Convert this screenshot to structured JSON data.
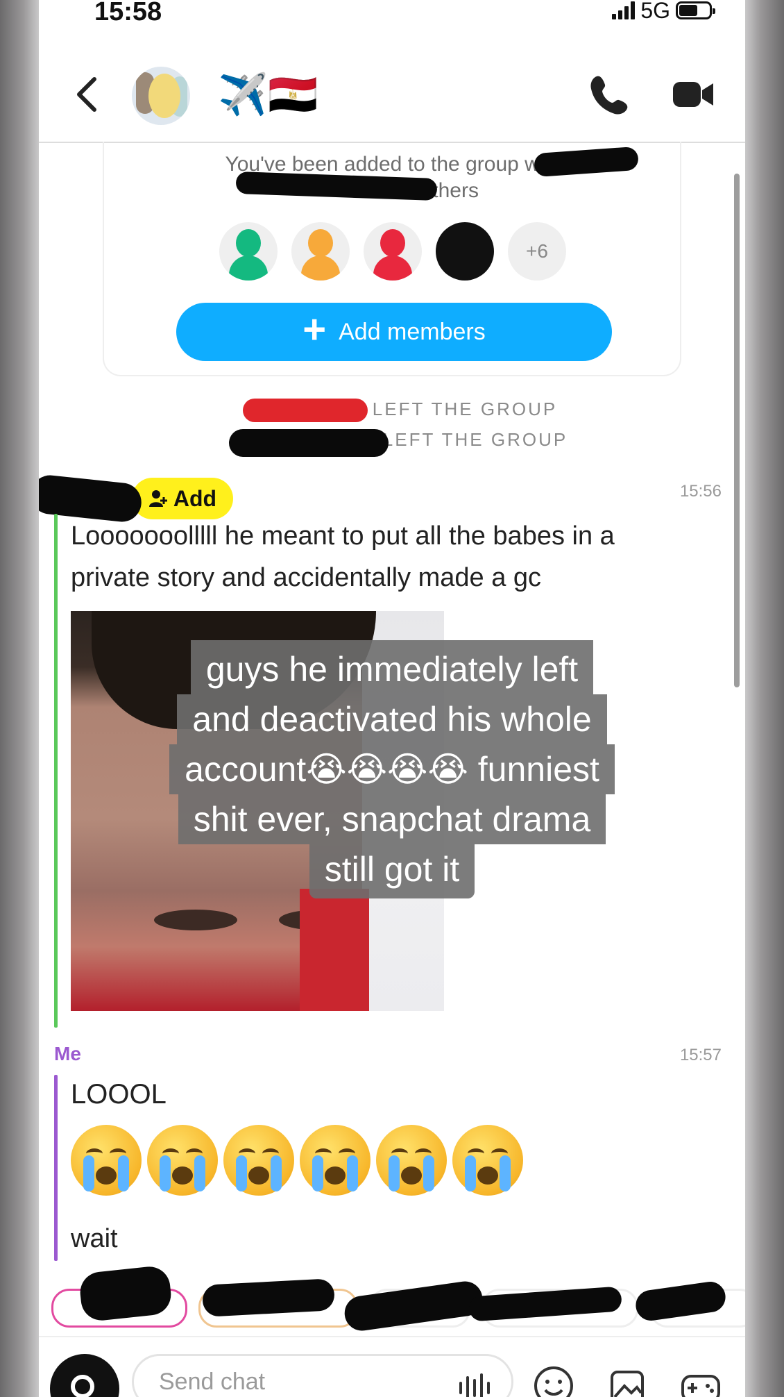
{
  "status_bar": {
    "time": "15:58",
    "network": "5G"
  },
  "header": {
    "group_name": "✈️🇪🇬"
  },
  "group_card": {
    "added_text": "You've been added to the group with",
    "others_text": "+6 others",
    "more_count": "+6",
    "add_members_label": "Add members"
  },
  "system_notes": [
    "LEFT THE GROUP",
    "LEFT THE GROUP"
  ],
  "message1": {
    "add_label": "Add",
    "timestamp": "15:56",
    "text_line1": "Looooooolllll he meant to put all the babes in a",
    "text_line2": "private story and accidentally made a gc"
  },
  "overlay_caption": {
    "lines": [
      "guys he immediately left",
      "and deactivated his whole",
      "account😭😭😭😭 funniest",
      "shit ever, snapchat drama",
      "still got it"
    ]
  },
  "message2": {
    "sender": "Me",
    "timestamp": "15:57",
    "text1": "LOOOL",
    "text2": "wait"
  },
  "composer": {
    "placeholder": "Send chat"
  },
  "colors": {
    "accent_blue": "#0fadff",
    "add_yellow": "#fff01c",
    "me_purple": "#9b59d0",
    "friend_green": "#5ac85a"
  }
}
